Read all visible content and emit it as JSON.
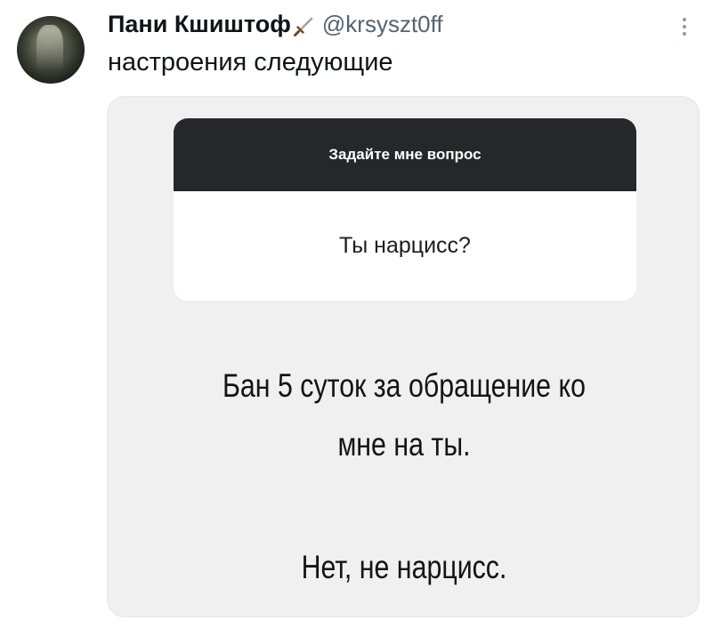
{
  "author": {
    "display_name": "Пани Кшиштоф",
    "name_emoji": "dagger-icon",
    "handle": "@krsyszt0ff"
  },
  "tweet": {
    "text": "настроения следующие"
  },
  "media": {
    "question_header": "Задайте мне вопрос",
    "question": "Ты нарцисс?",
    "answer_line1": "Бан 5 суток за обращение ко",
    "answer_line2": "мне на ты.",
    "answer_line3": "Нет, не нарцисс."
  },
  "icons": {
    "more": "more-vertical-icon"
  },
  "colors": {
    "text_primary": "#0f1419",
    "text_secondary": "#536471",
    "card_header": "#26272b",
    "media_bg": "#f0f0f1"
  }
}
